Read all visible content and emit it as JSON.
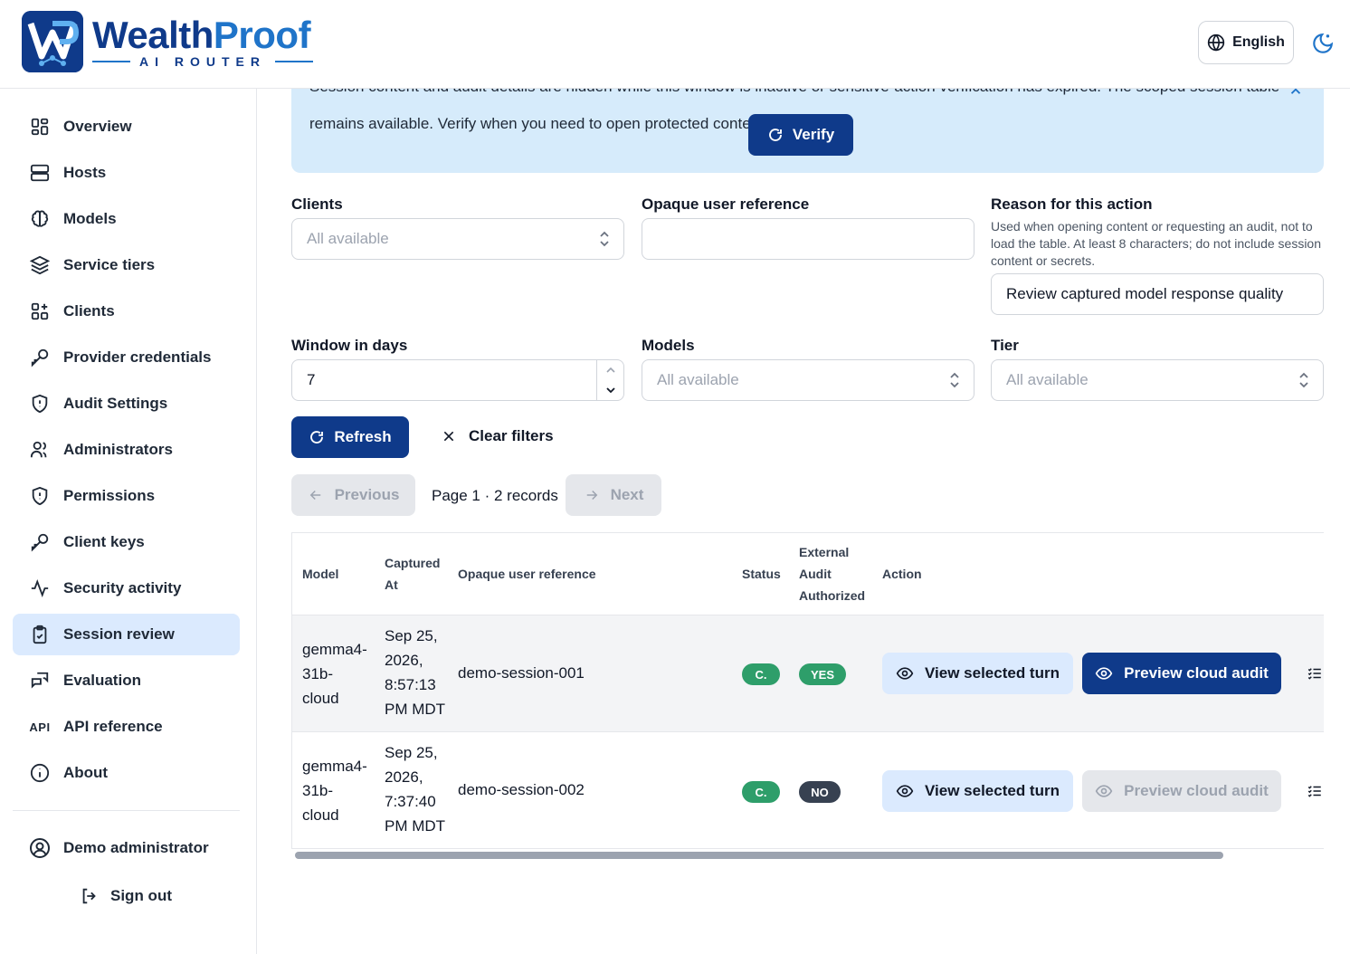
{
  "brand": {
    "name_part1": "Wealth",
    "name_part2": "Proof",
    "subtitle": "AI ROUTER",
    "colors": {
      "primary": "#0f3a8a",
      "accent": "#1f74c9"
    }
  },
  "header": {
    "language_label": "English",
    "language_icon": "globe-icon",
    "theme_icon": "moon-icon"
  },
  "sidebar": {
    "items": [
      {
        "label": "Overview",
        "icon": "grid-icon"
      },
      {
        "label": "Hosts",
        "icon": "server-icon"
      },
      {
        "label": "Models",
        "icon": "brain-icon"
      },
      {
        "label": "Service tiers",
        "icon": "layers-icon"
      },
      {
        "label": "Clients",
        "icon": "grid-plus-icon"
      },
      {
        "label": "Provider credentials",
        "icon": "key-icon"
      },
      {
        "label": "Audit Settings",
        "icon": "shield-icon"
      },
      {
        "label": "Administrators",
        "icon": "users-icon"
      },
      {
        "label": "Permissions",
        "icon": "shield-icon"
      },
      {
        "label": "Client keys",
        "icon": "key-icon"
      },
      {
        "label": "Security activity",
        "icon": "activity-icon"
      },
      {
        "label": "Session review",
        "icon": "clipboard-check-icon",
        "active": true
      },
      {
        "label": "Evaluation",
        "icon": "chat-icon"
      },
      {
        "label": "API reference",
        "icon_text": "API"
      },
      {
        "label": "About",
        "icon": "info-icon"
      }
    ],
    "user_name": "Demo administrator",
    "sign_out_label": "Sign out"
  },
  "banner": {
    "line1": "Session content and audit details are hidden while this window is inactive or sensitive-action verification has expired. The scoped session table",
    "line2": "remains available. Verify when you need to open protected content.",
    "verify_label": "Verify"
  },
  "filters": {
    "clients": {
      "label": "Clients",
      "placeholder": "All available"
    },
    "opaque_ref": {
      "label": "Opaque user reference",
      "value": ""
    },
    "reason": {
      "label": "Reason for this action",
      "help_line1": "Used when opening content or requesting an audit, not to",
      "help_line2": "load the table. At least 8 characters; do not include session",
      "help_line3": "content or secrets.",
      "value": "Review captured model response quality"
    },
    "window": {
      "label": "Window in days",
      "value": "7"
    },
    "models": {
      "label": "Models",
      "placeholder": "All available"
    },
    "tier": {
      "label": "Tier",
      "placeholder": "All available"
    }
  },
  "actions": {
    "refresh_label": "Refresh",
    "clear_label": "Clear filters"
  },
  "pagination": {
    "previous_label": "Previous",
    "info": "Page 1 · 2 records",
    "next_label": "Next"
  },
  "table": {
    "headers": {
      "model": "Model",
      "captured_1": "Captured",
      "captured_2": "At",
      "opaque": "Opaque user reference",
      "status": "Status",
      "external_1": "External",
      "external_2": "Audit",
      "external_3": "Authorized",
      "action": "Action"
    },
    "rows": [
      {
        "model_1": "gemma4-",
        "model_2": "31b-",
        "model_3": "cloud",
        "captured_1": "Sep 25,",
        "captured_2": "2026,",
        "captured_3": "8:57:13",
        "captured_4": "PM MDT",
        "opaque": "demo-session-001",
        "status": "C.",
        "external": "YES",
        "view_label": "View selected turn",
        "preview_label": "Preview cloud audit",
        "preview_enabled": true
      },
      {
        "model_1": "gemma4-",
        "model_2": "31b-",
        "model_3": "cloud",
        "captured_1": "Sep 25,",
        "captured_2": "2026,",
        "captured_3": "7:37:40",
        "captured_4": "PM MDT",
        "opaque": "demo-session-002",
        "status": "C.",
        "external": "NO",
        "view_label": "View selected turn",
        "preview_label": "Preview cloud audit",
        "preview_enabled": false
      }
    ]
  }
}
